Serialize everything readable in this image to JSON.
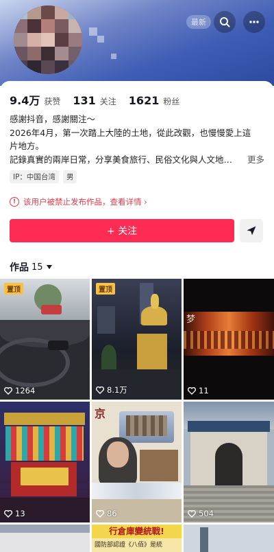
{
  "header": {
    "badge": "最新",
    "search_icon": "search-icon",
    "more_icon": "more-icon"
  },
  "stats": {
    "likes": {
      "value": "9.4万",
      "label": "获赞"
    },
    "following": {
      "value": "131",
      "label": "关注"
    },
    "followers": {
      "value": "1621",
      "label": "粉丝"
    }
  },
  "bio": {
    "lines": [
      "感謝抖音，感謝關注～",
      "2026年4月，第一次踏上大陸的土地，從此改觀，也慢慢愛上這",
      "片地方。",
      "記錄真實的兩岸日常，分享美食旅行、民俗文化與人文地…"
    ],
    "more": "更多"
  },
  "tags": [
    "IP：中国台湾",
    "男"
  ],
  "warning": "该用户被禁止发布作品，查看详情 ›",
  "follow_button": "+ 关注",
  "works": {
    "label": "作品",
    "count": "15"
  },
  "posts": [
    {
      "pinned": "置顶",
      "likes": "1264"
    },
    {
      "pinned": "置顶",
      "likes": "8.1万"
    },
    {
      "pinned": "",
      "likes": "11"
    },
    {
      "pinned": "",
      "likes": "13"
    },
    {
      "pinned": "",
      "likes": "86"
    },
    {
      "pinned": "",
      "likes": "504"
    }
  ],
  "tile_texts": {
    "jing": "京",
    "banner": "行倉庫變統戰!",
    "banner_sub": "國防部認證《八佰》是統"
  },
  "colors": {
    "accent": "#fe2c55",
    "warning": "#e8394b",
    "pin": "#f8c146"
  }
}
